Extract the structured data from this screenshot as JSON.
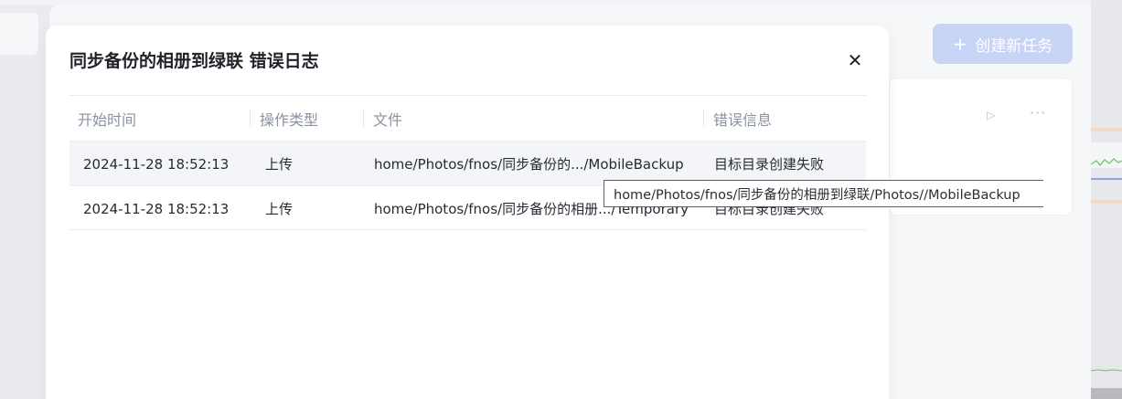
{
  "background": {
    "create_button_label": "创建新任务",
    "create_button_icon": "+",
    "task_card_play_icon": "▷",
    "task_card_more_icon": "···"
  },
  "modal": {
    "title": "同步备份的相册到绿联 错误日志",
    "close_icon": "✕",
    "columns": [
      "开始时间",
      "操作类型",
      "文件",
      "错误信息"
    ],
    "rows": [
      {
        "start_time": "2024-11-28 18:52:13",
        "op_type": "上传",
        "file": "home/Photos/fnos/同步备份的.../MobileBackup",
        "error": "目标目录创建失败"
      },
      {
        "start_time": "2024-11-28 18:52:13",
        "op_type": "上传",
        "file": "home/Photos/fnos/同步备份的相册.../Temporary",
        "error": "目标目录创建失败"
      }
    ]
  },
  "tooltip": {
    "text": "home/Photos/fnos/同步备份的相册到绿联/Photos//MobileBackup"
  }
}
